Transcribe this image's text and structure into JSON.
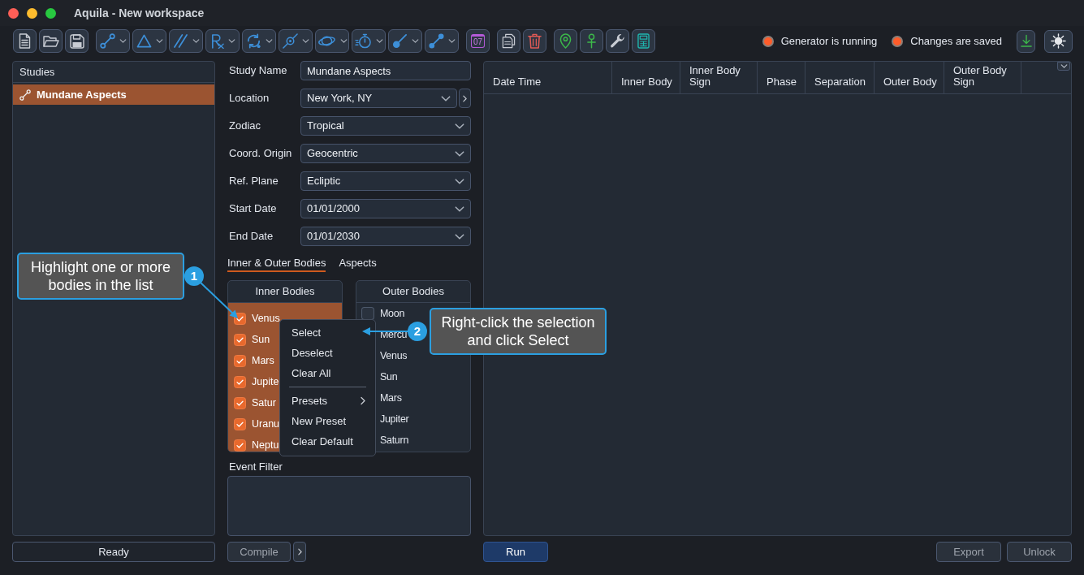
{
  "window": {
    "title": "Aquila - New workspace"
  },
  "toolbar": {
    "groups": [
      {
        "items": [
          {
            "kind": "button"
          },
          {
            "kind": "button"
          },
          {
            "kind": "button"
          }
        ]
      },
      {
        "items": [
          {
            "kind": "dropdown"
          },
          {
            "kind": "dropdown"
          },
          {
            "kind": "dropdown"
          },
          {
            "kind": "dropdown"
          },
          {
            "kind": "dropdown"
          },
          {
            "kind": "dropdown"
          },
          {
            "kind": "dropdown"
          },
          {
            "kind": "dropdown"
          },
          {
            "kind": "dropdown"
          },
          {
            "kind": "dropdown"
          }
        ]
      },
      {
        "items": [
          {
            "kind": "date",
            "label": "07"
          }
        ]
      },
      {
        "items": [
          {
            "kind": "button"
          },
          {
            "kind": "button"
          }
        ]
      },
      {
        "items": [
          {
            "kind": "button"
          },
          {
            "kind": "button"
          },
          {
            "kind": "button"
          },
          {
            "kind": "button"
          }
        ]
      }
    ],
    "status": [
      {
        "label": "Generator is running",
        "on": true
      },
      {
        "label": "Changes are saved",
        "on": true
      }
    ],
    "actions": [
      {
        "kind": "button"
      },
      {
        "kind": "button"
      }
    ]
  },
  "studies": {
    "title": "Studies",
    "items": [
      {
        "label": "Mundane Aspects",
        "selected": true
      }
    ]
  },
  "form": {
    "fields": [
      {
        "label": "Study Name",
        "kind": "text",
        "value": "Mundane Aspects"
      },
      {
        "label": "Location",
        "kind": "combo",
        "value": "New York, NY"
      },
      {
        "label": "Zodiac",
        "kind": "select",
        "value": "Tropical"
      },
      {
        "label": "Coord. Origin",
        "kind": "select",
        "value": "Geocentric"
      },
      {
        "label": "Ref. Plane",
        "kind": "select",
        "value": "Ecliptic"
      },
      {
        "label": "Start Date",
        "kind": "select",
        "value": "01/01/2000"
      },
      {
        "label": "End Date",
        "kind": "select",
        "value": "01/01/2030"
      }
    ]
  },
  "tabs": [
    {
      "label": "Inner & Outer Bodies",
      "selected": true
    },
    {
      "label": "Aspects",
      "selected": false
    }
  ],
  "bodies": {
    "inner": {
      "title": "Inner Bodies",
      "items": [
        {
          "label": "Venus",
          "checked": true,
          "selected": true
        },
        {
          "label": "Sun",
          "checked": true,
          "selected": true
        },
        {
          "label": "Mars",
          "checked": true,
          "selected": true
        },
        {
          "label": "Jupite",
          "checked": true,
          "selected": true
        },
        {
          "label": "Satur",
          "checked": true,
          "selected": true
        },
        {
          "label": "Uranu",
          "checked": true,
          "selected": true
        },
        {
          "label": "Neptu",
          "checked": true,
          "selected": true
        }
      ]
    },
    "outer": {
      "title": "Outer Bodies",
      "items": [
        {
          "label": "Moon",
          "checked": false,
          "selected": false
        },
        {
          "label": "Mercu",
          "selected": false
        },
        {
          "label": "Venus",
          "selected": false
        },
        {
          "label": "Sun",
          "selected": false
        },
        {
          "label": "Mars",
          "selected": false
        },
        {
          "label": "Jupiter",
          "selected": false
        },
        {
          "label": "Saturn",
          "selected": false
        }
      ]
    }
  },
  "event_filter": {
    "label": "Event Filter"
  },
  "table": {
    "columns": [
      "Date Time",
      "Inner Body",
      "Inner Body Sign",
      "Phase",
      "Separation",
      "Outer Body",
      "Outer Body Sign"
    ]
  },
  "footer": {
    "status": "Ready",
    "compile": {
      "label": "Compile",
      "disabled": true
    },
    "run": {
      "label": "Run"
    },
    "export": {
      "label": "Export",
      "disabled": true
    },
    "unlock": {
      "label": "Unlock",
      "disabled": true
    }
  },
  "context_menu": {
    "items": [
      {
        "kind": "item",
        "label": "Select"
      },
      {
        "kind": "item",
        "label": "Deselect"
      },
      {
        "kind": "item",
        "label": "Clear All"
      },
      {
        "kind": "separator"
      },
      {
        "kind": "submenu",
        "label": "Presets"
      },
      {
        "kind": "item",
        "label": "New Preset"
      },
      {
        "kind": "item",
        "label": "Clear Default"
      }
    ]
  },
  "callouts": [
    {
      "number": "1",
      "text": "Highlight one or more bodies in the list"
    },
    {
      "number": "2",
      "text": "Right-click the selection and click Select"
    }
  ]
}
